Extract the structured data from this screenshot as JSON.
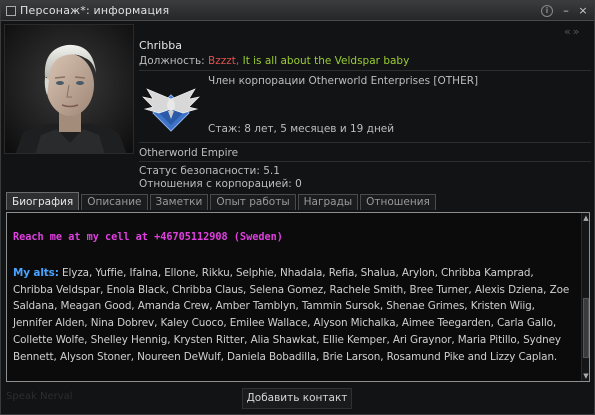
{
  "window": {
    "title": "Персонаж*: информация",
    "info_btn": "i",
    "minimize_btn": "–",
    "close_btn": "×",
    "nav_arrows": "«»"
  },
  "character": {
    "name": "Chribba",
    "position_label": "Должность:",
    "position_red": "Bzzzt,",
    "position_green": "It is all about the Veldspar baby",
    "corp_member": "Член корпорации Otherworld Enterprises [OTHER]",
    "tenure": "Стаж: 8 лет, 5 месяцев и 19 дней",
    "alliance": "Otherworld Empire",
    "security": "Статус безопасности: 5.1",
    "standing": "Отношения с корпорацией: 0"
  },
  "tabs": [
    {
      "label": "Биография",
      "active": true
    },
    {
      "label": "Описание",
      "active": false
    },
    {
      "label": "Заметки",
      "active": false
    },
    {
      "label": "Опыт работы",
      "active": false
    },
    {
      "label": "Награды",
      "active": false
    },
    {
      "label": "Отношения",
      "active": false
    }
  ],
  "bio": {
    "reach": "Reach me at my cell at +46705112908 (Sweden)",
    "alts_label": "My alts:",
    "alts_text": "Elyza, Yuffie, Ifalna, Ellone, Rikku, Selphie, Nhadala, Refia, Shalua, Arylon, Chribba Kamprad, Chribba Veldspar, Enola Black, Chribba Claus, Selena Gomez, Rachele Smith, Bree Turner, Alexis Dziena, Zoe Saldana, Meagan Good, Amanda Crew, Amber Tamblyn, Tammin Sursok, Shenae Grimes, Kristen Wiig, Jennifer Alden, Nina Dobrev, Kaley Cuoco, Emilee Wallace, Alyson Michalka, Aimee Teegarden, Carla Gallo, Collette Wolfe, Shelley Hennig, Krysten Ritter, Alia Shawkat, Ellie Kemper, Ari Graynor, Maria Pitillo, Sydney Bennett, Alyson Stoner, Noureen DeWulf, Daniela Bobadilla, Brie Larson, Rosamund Pike and Lizzy Caplan.",
    "scroll_up": "▲",
    "scroll_down": "▼"
  },
  "footer": {
    "faded_text": "Speak Nerval",
    "add_contact": "Добавить контакт"
  },
  "colors": {
    "position_red": "#e05050",
    "position_green": "#9acd32",
    "reach": "#e040e0",
    "alts_label": "#4aa3ff"
  }
}
